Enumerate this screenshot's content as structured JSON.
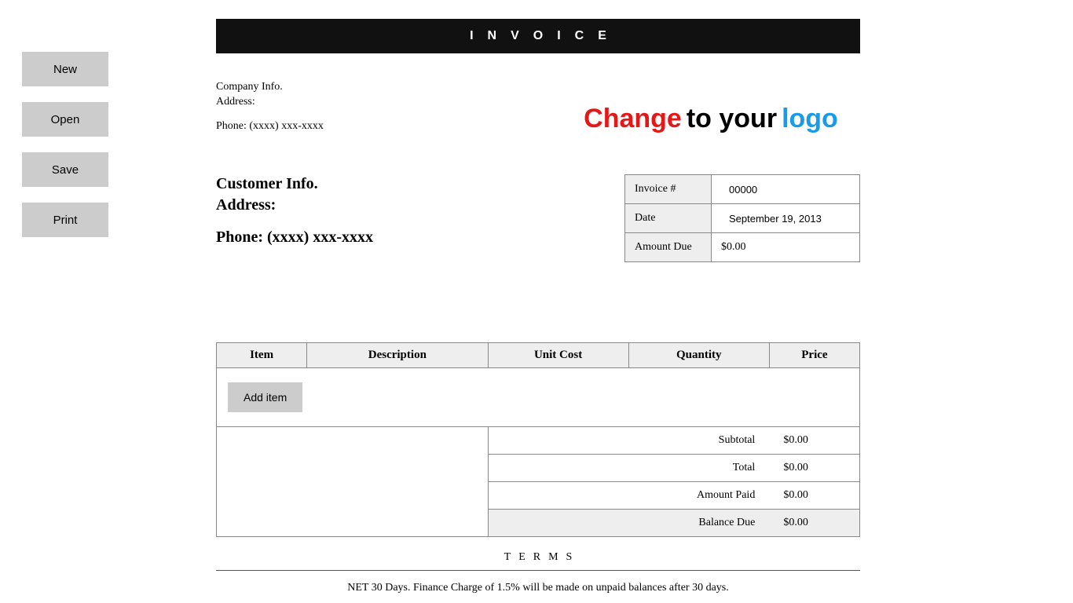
{
  "sidebar": {
    "new": "New",
    "open": "Open",
    "save": "Save",
    "print": "Print"
  },
  "banner": "INVOICE",
  "company": {
    "name": "Company Info.",
    "address": "Address:",
    "phone": "Phone: (xxxx) xxx-xxxx"
  },
  "logo": {
    "w1": "Change",
    "w2": "to your",
    "w3": "logo"
  },
  "customer": {
    "name": "Customer Info.",
    "address": "Address:",
    "phone": "Phone: (xxxx) xxx-xxxx"
  },
  "meta": {
    "invoice_label": "Invoice #",
    "invoice_value": "00000",
    "date_label": "Date",
    "date_value": "September 19, 2013",
    "amount_due_label": "Amount Due",
    "amount_due_value": "$0.00"
  },
  "items": {
    "headers": {
      "item": "Item",
      "description": "Description",
      "unit_cost": "Unit Cost",
      "quantity": "Quantity",
      "price": "Price"
    },
    "add_item": "Add item"
  },
  "totals": {
    "subtotal_label": "Subtotal",
    "subtotal_value": "$0.00",
    "total_label": "Total",
    "total_value": "$0.00",
    "paid_label": "Amount Paid",
    "paid_value": "$0.00",
    "balance_label": "Balance Due",
    "balance_value": "$0.00"
  },
  "terms": {
    "heading": "TERMS",
    "text": "NET 30 Days. Finance Charge of 1.5% will be made on unpaid balances after 30 days."
  }
}
